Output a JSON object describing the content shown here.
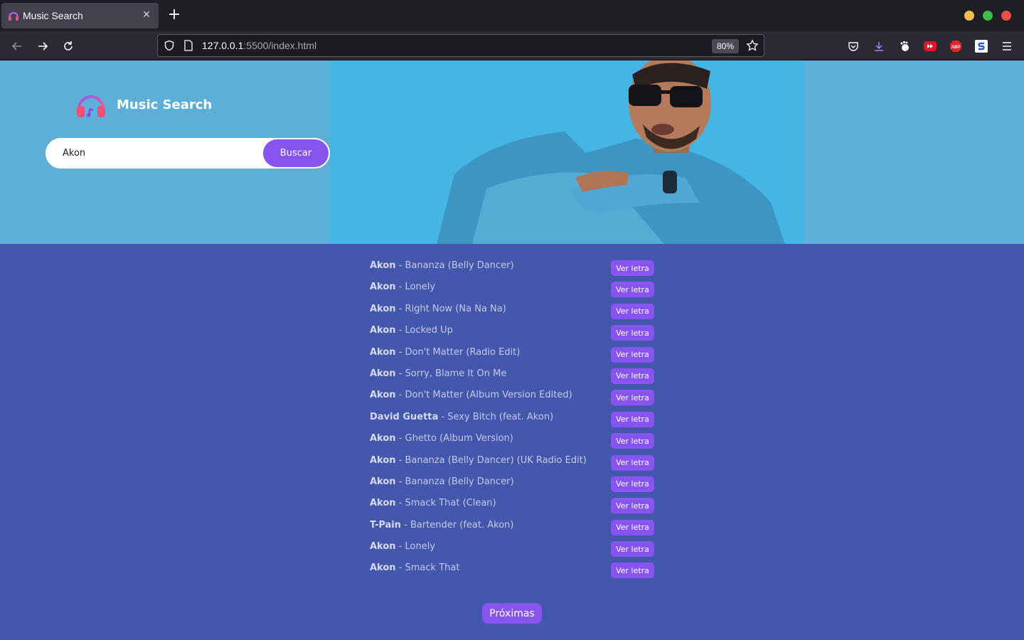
{
  "browser": {
    "tab_title": "Music Search",
    "tab_close": "✕",
    "new_tab": "+",
    "url_host": "127.0.0.1",
    "url_rest": ":5500/index.html",
    "zoom": "80%"
  },
  "colors": {
    "accent": "#8854f0",
    "hero_bg": "#5dafd8",
    "page_bg": "#4357ad"
  },
  "header": {
    "logo_text": "Music Search",
    "search_value": "Akon",
    "search_button": "Buscar"
  },
  "results": [
    {
      "artist": "Akon",
      "title": "Bananza (Belly Dancer)",
      "button": "Ver letra"
    },
    {
      "artist": "Akon",
      "title": "Lonely",
      "button": "Ver letra"
    },
    {
      "artist": "Akon",
      "title": "Right Now (Na Na Na)",
      "button": "Ver letra"
    },
    {
      "artist": "Akon",
      "title": "Locked Up",
      "button": "Ver letra"
    },
    {
      "artist": "Akon",
      "title": "Don't Matter (Radio Edit)",
      "button": "Ver letra"
    },
    {
      "artist": "Akon",
      "title": "Sorry, Blame It On Me",
      "button": "Ver letra"
    },
    {
      "artist": "Akon",
      "title": "Don't Matter (Album Version Edited)",
      "button": "Ver letra"
    },
    {
      "artist": "David Guetta",
      "title": "Sexy Bitch (feat. Akon)",
      "button": "Ver letra"
    },
    {
      "artist": "Akon",
      "title": "Ghetto (Album Version)",
      "button": "Ver letra"
    },
    {
      "artist": "Akon",
      "title": "Bananza (Belly Dancer) (UK Radio Edit)",
      "button": "Ver letra"
    },
    {
      "artist": "Akon",
      "title": "Bananza (Belly Dancer)",
      "button": "Ver letra"
    },
    {
      "artist": "Akon",
      "title": "Smack That (Clean)",
      "button": "Ver letra"
    },
    {
      "artist": "T-Pain",
      "title": "Bartender (feat. Akon)",
      "button": "Ver letra"
    },
    {
      "artist": "Akon",
      "title": "Lonely",
      "button": "Ver letra"
    },
    {
      "artist": "Akon",
      "title": "Smack That",
      "button": "Ver letra"
    }
  ],
  "pagination": {
    "next_label": "Próximas"
  }
}
